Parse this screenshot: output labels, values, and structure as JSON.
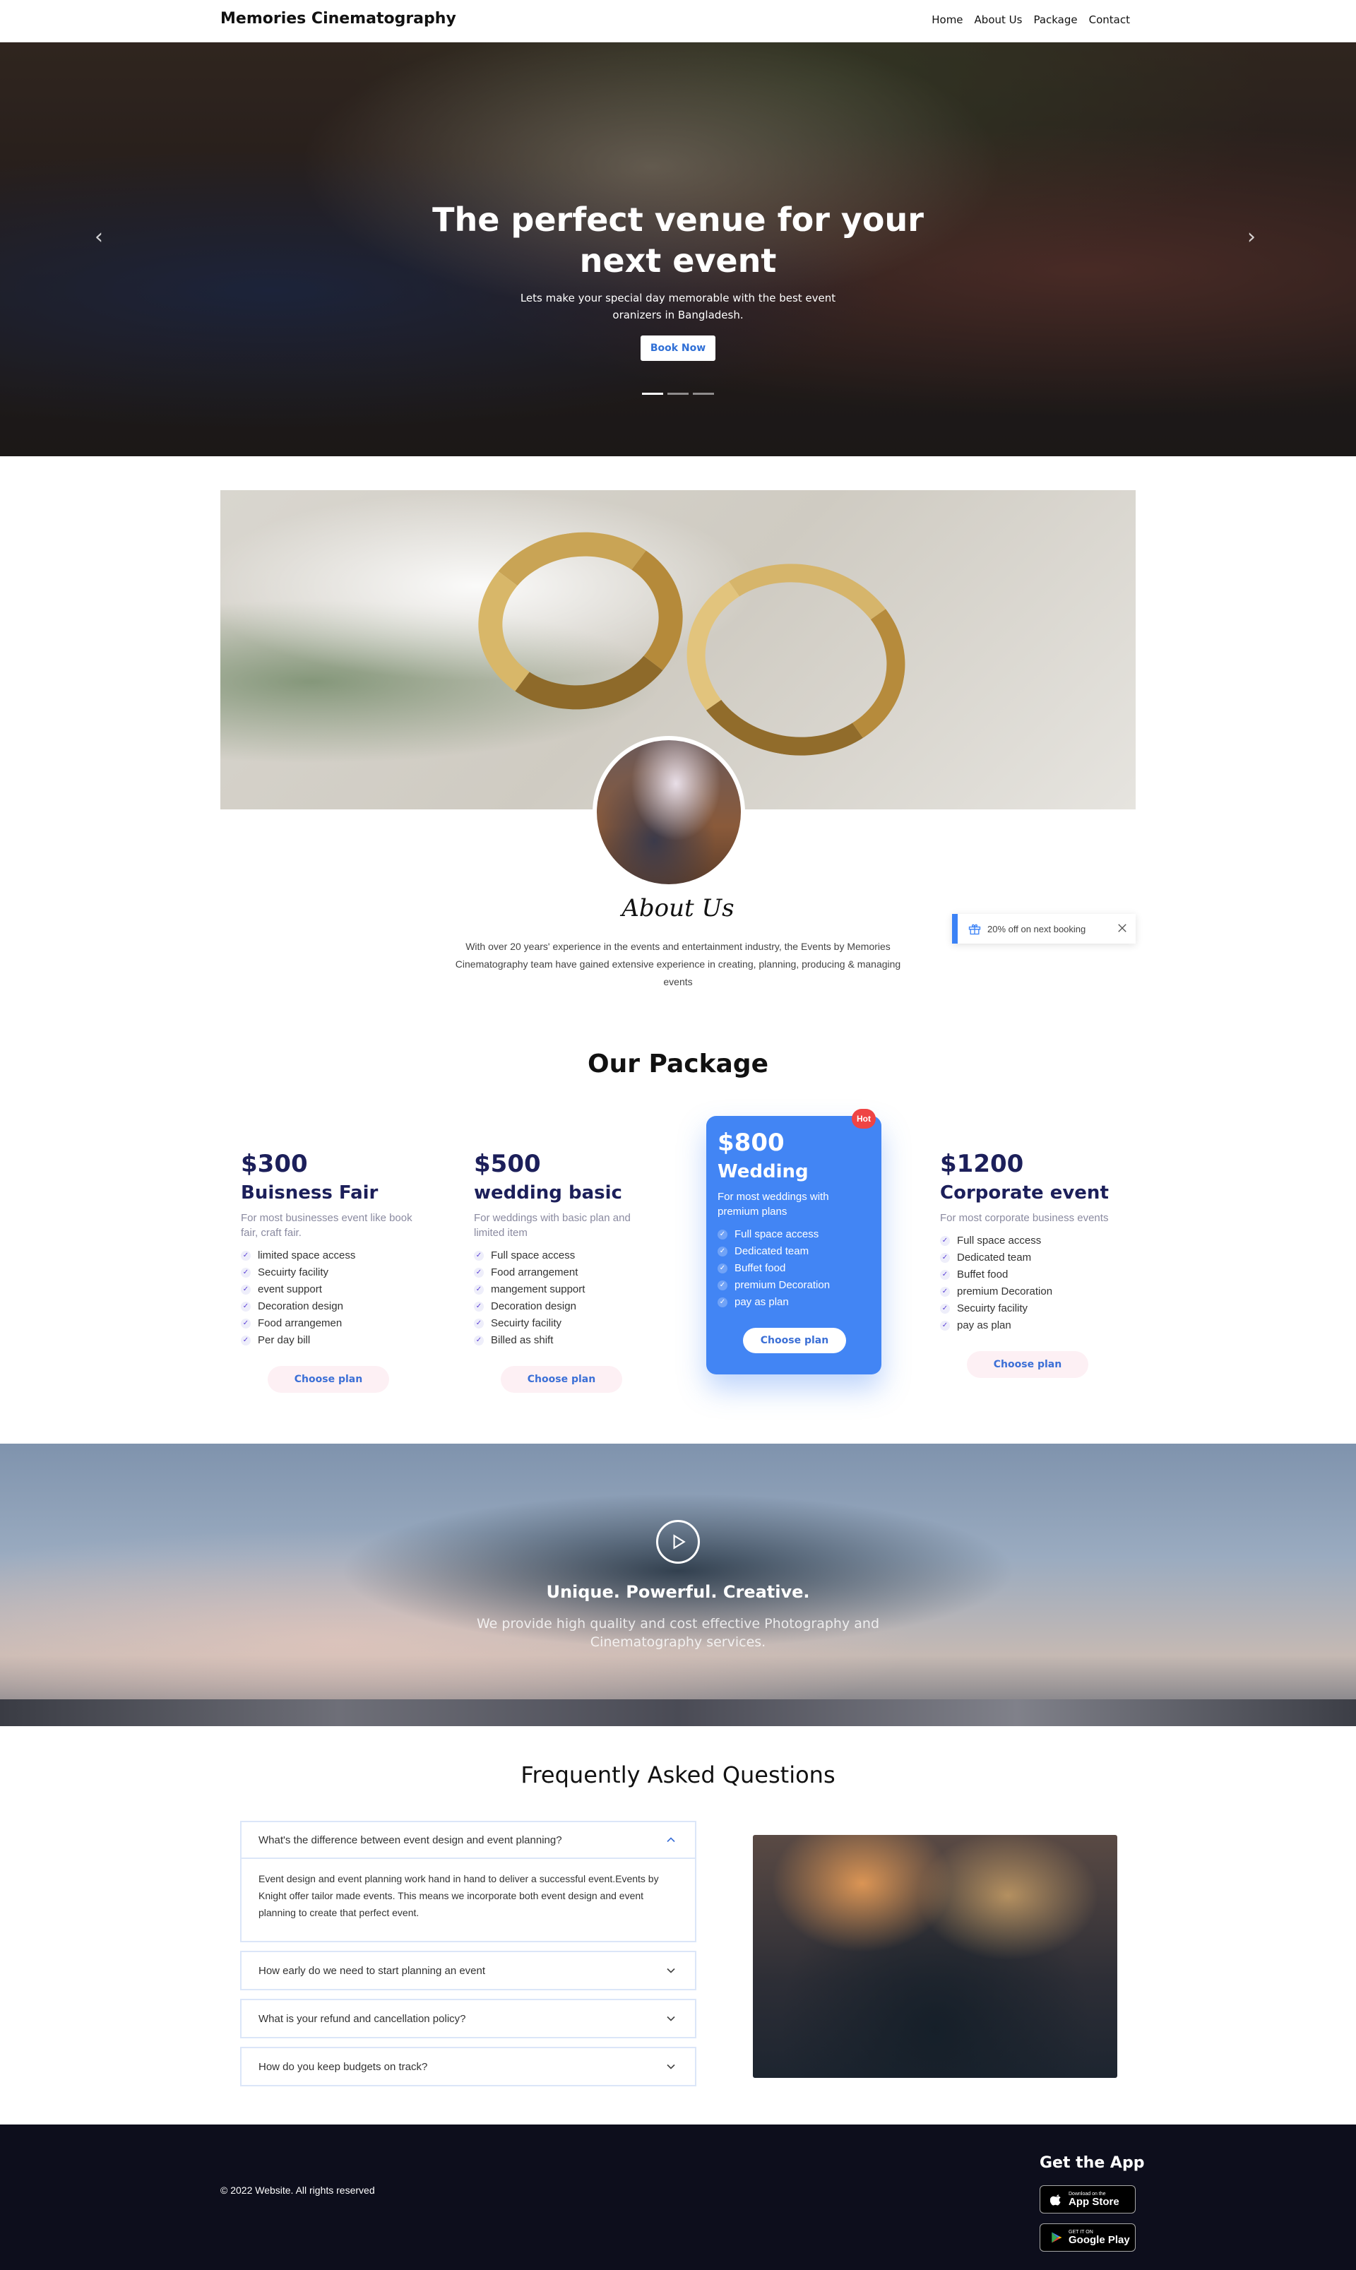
{
  "brand": "Memories Cinematography",
  "nav": {
    "items": [
      "Home",
      "About Us",
      "Package",
      "Contact"
    ]
  },
  "hero": {
    "title": "The perfect venue for your next event",
    "subtitle": "Lets make your special day memorable with the best event oranizers in Bangladesh.",
    "button_label": "Book Now",
    "prev_icon": "chevron-left-icon",
    "next_icon": "chevron-right-icon",
    "slides": 3,
    "active_slide": 1
  },
  "about": {
    "title": "About Us",
    "text": "With over 20 years' experience in the events and entertainment industry, the Events by Memories Cinematography team have gained extensive experience in creating, planning, producing & managing events"
  },
  "promo": {
    "text": "20% off on next booking",
    "icon": "gift-icon",
    "close_icon": "close-icon",
    "accent": "#3b82f6"
  },
  "packages": {
    "title": "Our Package",
    "plans": [
      {
        "price": "$300",
        "name": "Buisness Fair",
        "description": "For most businesses event like book fair, craft fair.",
        "features": [
          "limited space access",
          "Secuirty facility",
          "event support",
          "Decoration design",
          "Food arrangemen",
          "Per day bill"
        ],
        "button": "Choose plan",
        "featured": false
      },
      {
        "price": "$500",
        "name": "wedding basic",
        "description": "For weddings with basic plan and limited item",
        "features": [
          "Full space access",
          "Food arrangement",
          "mangement support",
          "Decoration design",
          "Secuirty facility",
          "Billed as shift"
        ],
        "button": "Choose plan",
        "featured": false
      },
      {
        "price": "$800",
        "name": "Wedding",
        "description": "For most weddings with premium plans",
        "features": [
          "Full space access",
          "Dedicated team",
          "Buffet food",
          "premium Decoration",
          "pay as plan"
        ],
        "button": "Choose plan",
        "featured": true,
        "badge": "Hot"
      },
      {
        "price": "$1200",
        "name": "Corporate event",
        "description": "For most corporate business events",
        "features": [
          "Full space access",
          "Dedicated team",
          "Buffet food",
          "premium Decoration",
          "Secuirty facility",
          "pay as plan"
        ],
        "button": "Choose plan",
        "featured": false
      }
    ]
  },
  "video": {
    "title": "Unique. Powerful. Creative.",
    "subtitle": "We provide high quality and cost effective Photography and Cinematography services.",
    "play_icon": "play-icon"
  },
  "faq": {
    "title": "Frequently Asked Questions",
    "items": [
      {
        "question": "What's the difference between event design and event planning?",
        "answer": "Event design and event planning work hand in hand to deliver a successful event.Events by Knight offer tailor made events. This means we incorporate both event design and event planning to create that perfect event.",
        "open": true
      },
      {
        "question": "How early do we need to start planning an event",
        "open": false
      },
      {
        "question": "What is your refund and cancellation policy?",
        "open": false
      },
      {
        "question": "How do you keep budgets on track?",
        "open": false
      }
    ]
  },
  "footer": {
    "copyright": "© 2022 Website. All rights reserved",
    "get_app": "Get the App",
    "app_store": {
      "small": "Download on the",
      "big": "App Store",
      "icon": "apple-icon"
    },
    "google_play": {
      "small": "GET IT ON",
      "big": "Google Play",
      "icon": "google-play-icon"
    },
    "background": "#0d0e1c"
  }
}
